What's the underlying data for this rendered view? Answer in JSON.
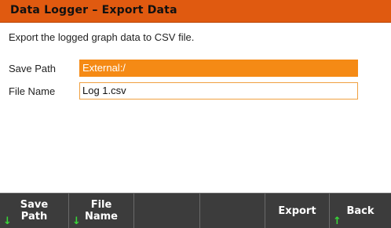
{
  "title": "Data Logger – Export Data",
  "description": "Export the logged graph data to CSV file.",
  "fields": {
    "save_path": {
      "label": "Save Path",
      "value": "External:/"
    },
    "file_name": {
      "label": "File Name",
      "value": "Log 1.csv"
    }
  },
  "softkeys": [
    {
      "line1": "Save",
      "line2": "Path",
      "arrow": "↓"
    },
    {
      "line1": "File",
      "line2": "Name",
      "arrow": "↓"
    },
    {
      "line1": "",
      "line2": "",
      "arrow": ""
    },
    {
      "line1": "",
      "line2": "",
      "arrow": ""
    },
    {
      "line1": "Export",
      "line2": "",
      "arrow": ""
    },
    {
      "line1": "Back",
      "line2": "",
      "arrow": "↑"
    }
  ],
  "colors": {
    "title_bar": "#e05a10",
    "selected_field": "#f58a15",
    "softkey_bar": "#3c3c3c",
    "arrow": "#38d838"
  }
}
